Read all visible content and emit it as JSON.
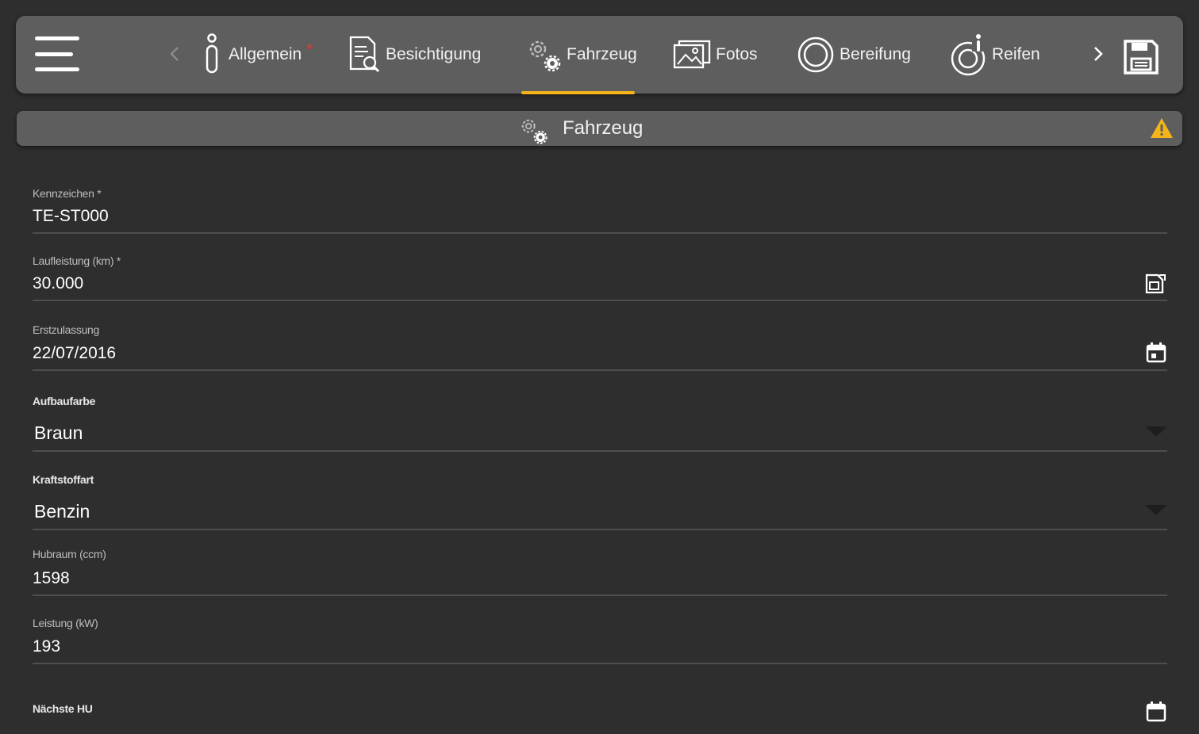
{
  "toolbar": {
    "tabs": [
      {
        "label": "Allgemein",
        "icon": "info-icon",
        "required_mark": "*"
      },
      {
        "label": "Besichtigung",
        "icon": "inspection-icon"
      },
      {
        "label": "Fahrzeug",
        "icon": "gears-icon"
      },
      {
        "label": "Fotos",
        "icon": "photos-icon"
      },
      {
        "label": "Bereifung",
        "icon": "tire-icon"
      },
      {
        "label": "Reifen",
        "icon": "tire-info-icon"
      }
    ],
    "active_tab": "Fahrzeug",
    "accent_color": "#f5b41a"
  },
  "section": {
    "title": "Fahrzeug",
    "icon": "gears-icon",
    "status_icon": "warning-icon",
    "status_color": "#f5b41a"
  },
  "form": {
    "kennzeichen": {
      "label": "Kennzeichen *",
      "value": "TE-ST000"
    },
    "laufleistung": {
      "label": "Laufleistung (km) *",
      "value": "30.000",
      "icon": "document-edit-icon"
    },
    "erstzulassung": {
      "label": "Erstzulassung",
      "value": "22/07/2016",
      "icon": "calendar-icon"
    },
    "aufbaufarbe": {
      "label": "Aufbaufarbe",
      "value": "Braun"
    },
    "kraftstoffart": {
      "label": "Kraftstoffart",
      "value": "Benzin"
    },
    "hubraum": {
      "label": "Hubraum (ccm)",
      "value": "1598"
    },
    "leistung": {
      "label": "Leistung (kW)",
      "value": "193"
    },
    "naechste_hu": {
      "label": "Nächste HU",
      "icon": "calendar-icon"
    }
  }
}
